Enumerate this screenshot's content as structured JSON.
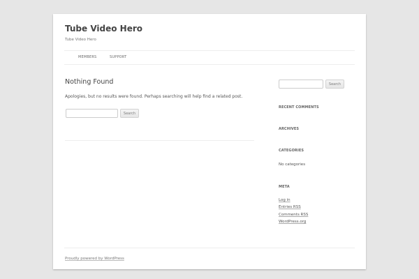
{
  "site": {
    "title": "Tube Video Hero",
    "description": "Tube Video Hero"
  },
  "nav": {
    "items": [
      {
        "label": "MEMBERS"
      },
      {
        "label": "SUPPORT"
      }
    ]
  },
  "main": {
    "title": "Nothing Found",
    "message": "Apologies, but no results were found. Perhaps searching will help find a related post.",
    "search": {
      "value": "",
      "button_label": "Search"
    }
  },
  "sidebar": {
    "search": {
      "value": "",
      "button_label": "Search"
    },
    "recent_comments_title": "RECENT COMMENTS",
    "archives_title": "ARCHIVES",
    "categories_title": "CATEGORIES",
    "categories_text": "No categories",
    "meta_title": "META",
    "meta_links": [
      {
        "label": "Log in"
      },
      {
        "label": "Entries RSS"
      },
      {
        "label": "Comments RSS"
      },
      {
        "label": "WordPress.org"
      }
    ]
  },
  "footer": {
    "credit": "Proudly powered by WordPress"
  }
}
